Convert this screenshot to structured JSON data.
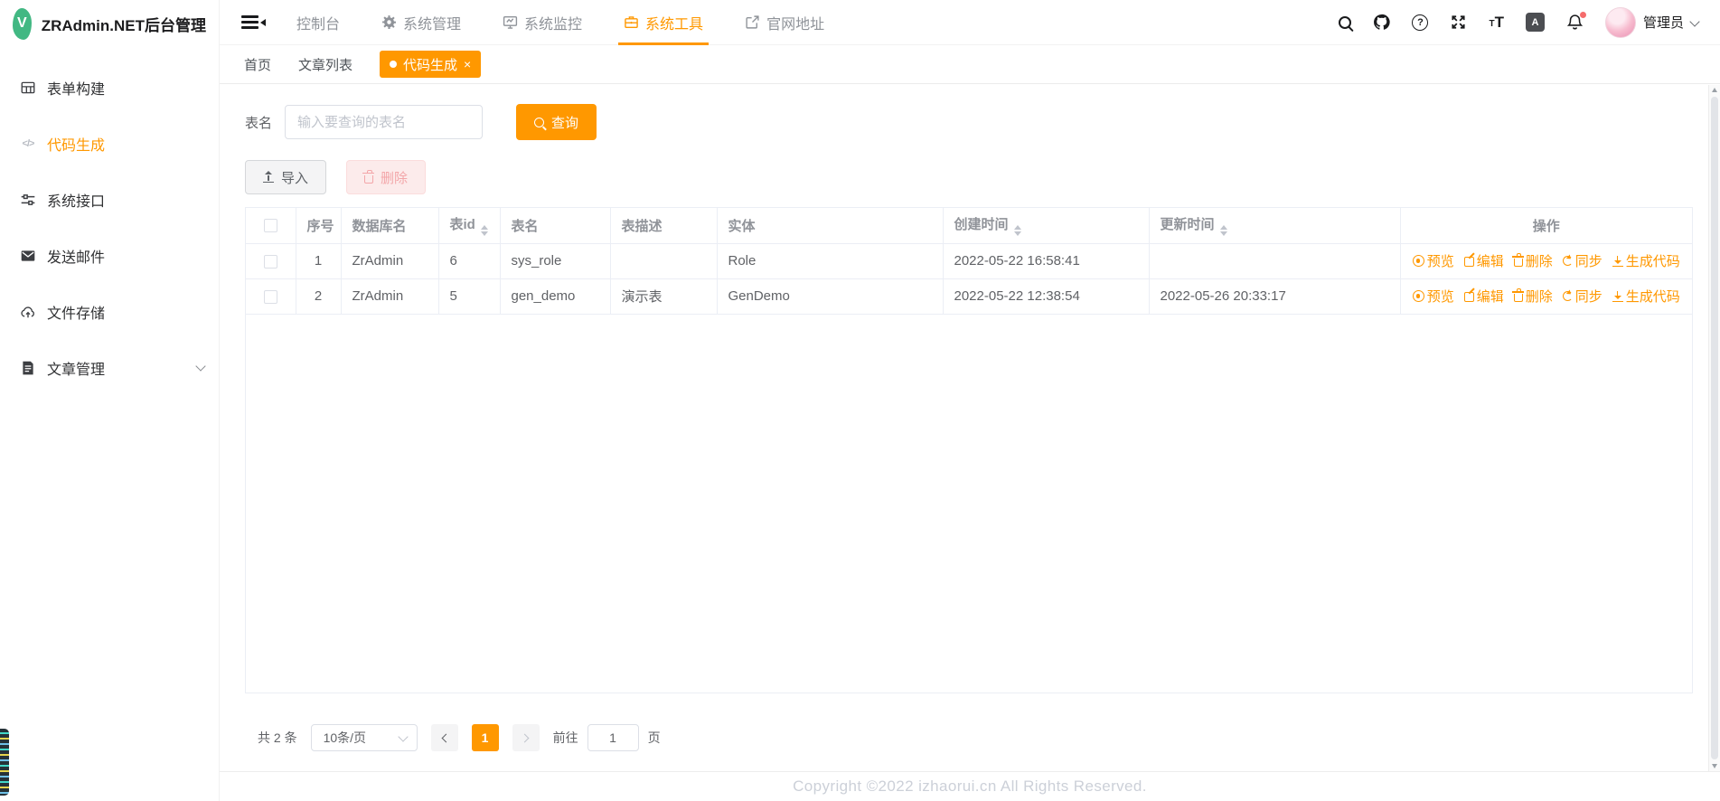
{
  "app": {
    "title": "ZRAdmin.NET后台管理",
    "logo_letter": "V"
  },
  "colors": {
    "accent": "#ff9800",
    "brand_green": "#42b883",
    "danger": "#f56c6c"
  },
  "sidebar": {
    "items": [
      {
        "label": "表单构建",
        "icon": "grid-icon",
        "active": false
      },
      {
        "label": "代码生成",
        "icon": "code-icon",
        "active": true
      },
      {
        "label": "系统接口",
        "icon": "sliders-icon",
        "active": false
      },
      {
        "label": "发送邮件",
        "icon": "mail-icon",
        "active": false
      },
      {
        "label": "文件存储",
        "icon": "cloud-upload-icon",
        "active": false
      },
      {
        "label": "文章管理",
        "icon": "document-icon",
        "active": false,
        "expandable": true
      }
    ]
  },
  "topnav": {
    "items": [
      {
        "label": "控制台",
        "icon": "",
        "active": false
      },
      {
        "label": "系统管理",
        "icon": "gear-icon",
        "active": false
      },
      {
        "label": "系统监控",
        "icon": "monitor-icon",
        "active": false
      },
      {
        "label": "系统工具",
        "icon": "briefcase-icon",
        "active": true
      },
      {
        "label": "官网地址",
        "icon": "external-link-icon",
        "active": false
      }
    ],
    "user": {
      "name": "管理员"
    }
  },
  "icons": {
    "help_glyph": "?",
    "code_glyph": "</>",
    "font_small": "T",
    "font_big": "T",
    "translate_glyph": "A",
    "tab_close_glyph": "×"
  },
  "tabs": [
    {
      "label": "首页",
      "active": false
    },
    {
      "label": "文章列表",
      "active": false
    },
    {
      "label": "代码生成",
      "active": true,
      "close_glyph": "×"
    }
  ],
  "search": {
    "label": "表名",
    "placeholder": "输入要查询的表名",
    "button": "查询"
  },
  "toolbar": {
    "import_label": "导入",
    "delete_label": "删除"
  },
  "table": {
    "columns": [
      "序号",
      "数据库名",
      "表id",
      "表名",
      "表描述",
      "实体",
      "创建时间",
      "更新时间",
      "操作"
    ],
    "sortable_columns": [
      "表id",
      "创建时间",
      "更新时间"
    ],
    "rows": [
      {
        "seq": "1",
        "db": "ZrAdmin",
        "table_id": "6",
        "name": "sys_role",
        "desc": "",
        "entity": "Role",
        "created": "2022-05-22 16:58:41",
        "updated": ""
      },
      {
        "seq": "2",
        "db": "ZrAdmin",
        "table_id": "5",
        "name": "gen_demo",
        "desc": "演示表",
        "entity": "GenDemo",
        "created": "2022-05-22 12:38:54",
        "updated": "2022-05-26 20:33:17"
      }
    ],
    "actions": [
      "预览",
      "编辑",
      "删除",
      "同步",
      "生成代码"
    ]
  },
  "pagination": {
    "total": "共 2 条",
    "page_size": "10条/页",
    "current_page": "1",
    "goto_label": "前往",
    "goto_value": "1",
    "page_unit": "页"
  },
  "footer": {
    "copyright": "Copyright ©2022 izhaorui.cn All Rights Reserved."
  }
}
